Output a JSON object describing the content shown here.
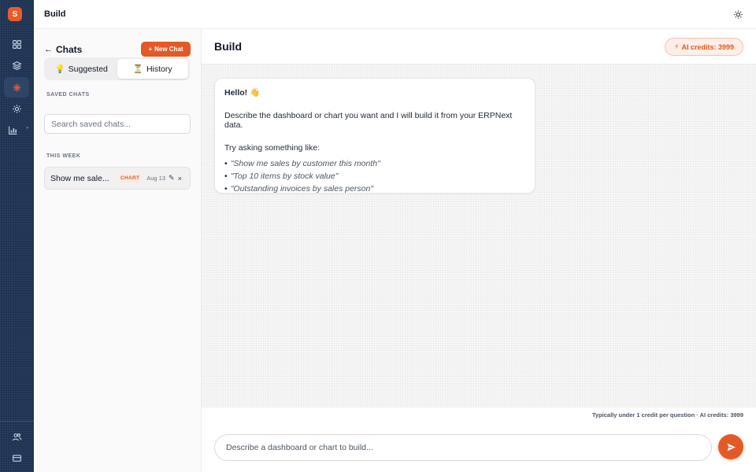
{
  "rail": {
    "logo_letter": "S",
    "items": [
      {
        "icon": "grid-icon"
      },
      {
        "icon": "layers-icon"
      },
      {
        "icon": "sparkle-icon",
        "active": true
      },
      {
        "icon": "sun-icon"
      },
      {
        "icon": "chart-icon"
      }
    ],
    "bottom": [
      {
        "icon": "users-icon"
      },
      {
        "icon": "card-icon"
      }
    ],
    "accent": "#ea5a2b"
  },
  "topbar": {
    "title": "Build",
    "theme_icon": "sun-icon"
  },
  "panel": {
    "back_label": "Chats",
    "new_chat_label": "New Chat",
    "tabs": [
      {
        "icon": "💡",
        "label": "Suggested"
      },
      {
        "icon": "⏳",
        "label": "History",
        "active": true
      }
    ],
    "saved_label": "SAVED CHATS",
    "search_placeholder": "Search saved chats...",
    "week_label": "THIS WEEK",
    "chats": [
      {
        "title": "Show me sale...",
        "badge": "CHART",
        "date": "Aug 13"
      }
    ]
  },
  "main": {
    "title": "Build",
    "credits_label": "AI credits: 3999",
    "message": {
      "greeting": "Hello! 👋",
      "intro": "Describe the dashboard or chart you want and I will build it from your ERPNext data.",
      "try_label": "Try asking something like:",
      "examples": [
        "\"Show me sales by customer this month\"",
        "\"Top 10 items by stock value\"",
        "\"Outstanding invoices by sales person\""
      ]
    },
    "footnote": "Typically under 1 credit per question · AI credits: 3999",
    "input_placeholder": "Describe a dashboard or chart to build..."
  },
  "colors": {
    "brand": "#e35a26",
    "rail": "#1e3252"
  }
}
